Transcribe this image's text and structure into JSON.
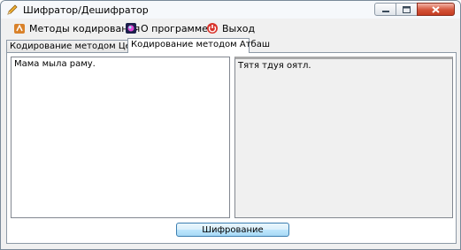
{
  "window": {
    "title": "Шифратор/Дешифратор"
  },
  "menu": [
    {
      "label": "Методы кодирования",
      "icon": "encoding-methods-icon"
    },
    {
      "label": "О программе",
      "icon": "about-icon"
    },
    {
      "label": "Выход",
      "icon": "exit-icon"
    }
  ],
  "tabs": [
    {
      "label": "Кодирование методом Цезаря",
      "active": false
    },
    {
      "label": "Кодирование методом Атбаш",
      "active": true
    }
  ],
  "input_text": "Мама мыла раму.",
  "output_text": "Тятя тдуя оятл.",
  "encode_button": "Шифрование",
  "colors": {
    "close_button": "#c43c22",
    "encode_button": "#bee6fd"
  }
}
